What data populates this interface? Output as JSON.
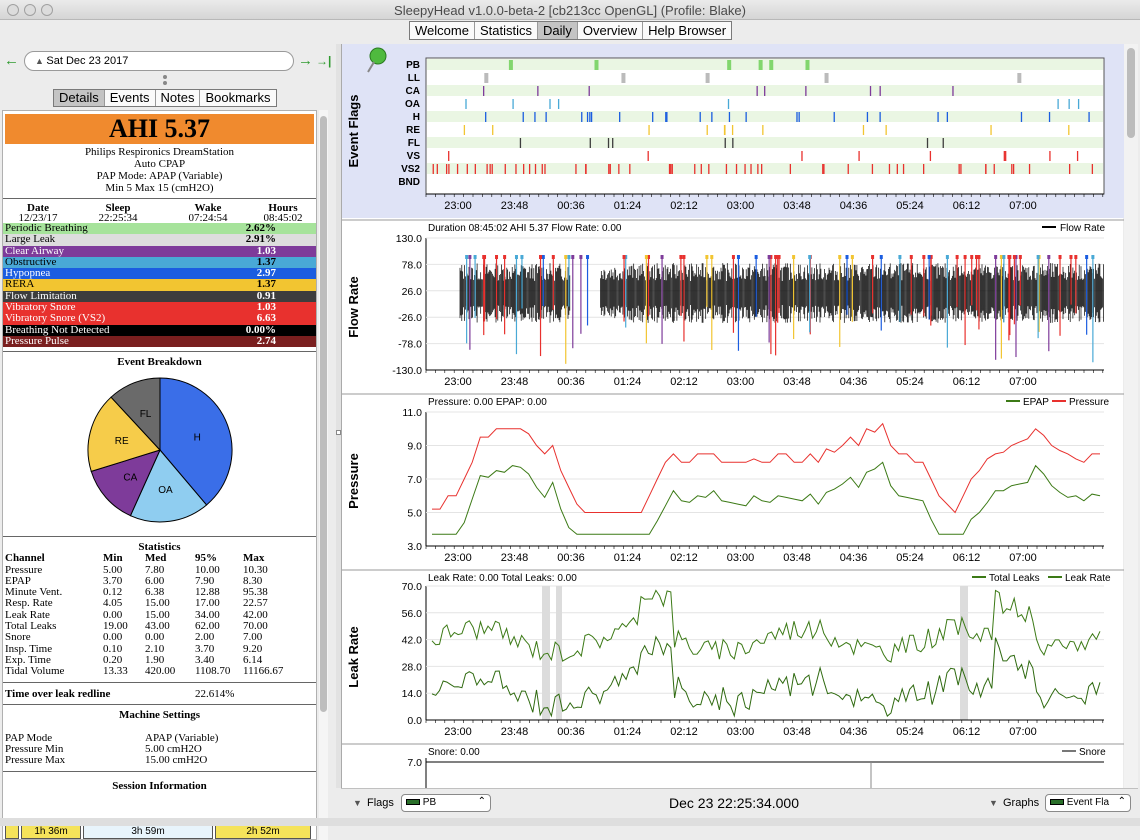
{
  "window": {
    "title": "SleepyHead v1.0.0-beta-2 [cb213cc OpenGL] (Profile: Blake)"
  },
  "tabs": [
    "Welcome",
    "Statistics",
    "Daily",
    "Overview",
    "Help Browser"
  ],
  "active_tab": "Daily",
  "date_nav": {
    "date": "Sat Dec 23 2017",
    "prev": "←",
    "next": "→",
    "last": "→|"
  },
  "subtabs": [
    "Details",
    "Events",
    "Notes",
    "Bookmarks"
  ],
  "report": {
    "ahi": "AHI 5.37",
    "machine": [
      "Philips Respironics DreamStation",
      "Auto CPAP",
      "PAP Mode: APAP (Variable)",
      "Min 5 Max 15 (cmH2O)"
    ],
    "times_header": [
      "Date",
      "Sleep",
      "Wake",
      "Hours"
    ],
    "times": [
      "12/23/17",
      "22:25:34",
      "07:24:54",
      "08:45:02"
    ],
    "events": [
      {
        "name": "Periodic Breathing",
        "value": "2.62%",
        "bg": "#a6e39b",
        "fg": "#000"
      },
      {
        "name": "Large Leak",
        "value": "2.91%",
        "bg": "#dddddd",
        "fg": "#000"
      },
      {
        "name": "Clear Airway",
        "value": "1.03",
        "bg": "#7e3b9a",
        "fg": "#fff"
      },
      {
        "name": "Obstructive",
        "value": "1.37",
        "bg": "#49a9d6",
        "fg": "#000"
      },
      {
        "name": "Hypopnea",
        "value": "2.97",
        "bg": "#1b5de0",
        "fg": "#fff"
      },
      {
        "name": "RERA",
        "value": "1.37",
        "bg": "#f2c531",
        "fg": "#000"
      },
      {
        "name": "Flow Limitation",
        "value": "0.91",
        "bg": "#3d3d3d",
        "fg": "#fff"
      },
      {
        "name": "Vibratory Snore",
        "value": "1.03",
        "bg": "#e8312e",
        "fg": "#fff"
      },
      {
        "name": "Vibratory Snore (VS2)",
        "value": "6.63",
        "bg": "#e8312e",
        "fg": "#fff"
      },
      {
        "name": "Breathing Not Detected",
        "value": "0.00%",
        "bg": "#000000",
        "fg": "#fff"
      },
      {
        "name": "Pressure Pulse",
        "value": "2.74",
        "bg": "#7a1f1f",
        "fg": "#fff"
      }
    ],
    "breakdown_title": "Event Breakdown",
    "pie": [
      {
        "label": "H",
        "pct": 0.297,
        "color": "#3a6ee8"
      },
      {
        "label": "OA",
        "pct": 0.137,
        "color": "#8fcdf0"
      },
      {
        "label": "CA",
        "pct": 0.103,
        "color": "#7e3b9a"
      },
      {
        "label": "RE",
        "pct": 0.137,
        "color": "#f6cc4a"
      },
      {
        "label": "FL",
        "pct": 0.091,
        "color": "#6a6a6a"
      }
    ],
    "stats_title": "Statistics",
    "stats_header": [
      "Channel",
      "Min",
      "Med",
      "95%",
      "Max"
    ],
    "stats": [
      [
        "Pressure",
        "5.00",
        "7.80",
        "10.00",
        "10.30"
      ],
      [
        "EPAP",
        "3.70",
        "6.00",
        "7.90",
        "8.30"
      ],
      [
        "Minute Vent.",
        "0.12",
        "6.38",
        "12.88",
        "95.38"
      ],
      [
        "Resp. Rate",
        "4.05",
        "15.00",
        "17.00",
        "22.57"
      ],
      [
        "Leak Rate",
        "0.00",
        "15.00",
        "34.00",
        "42.00"
      ],
      [
        "Total Leaks",
        "19.00",
        "43.00",
        "62.00",
        "70.00"
      ],
      [
        "Snore",
        "0.00",
        "0.00",
        "2.00",
        "7.00"
      ],
      [
        "Insp. Time",
        "0.10",
        "2.10",
        "3.70",
        "9.20"
      ],
      [
        "Exp. Time",
        "0.20",
        "1.90",
        "3.40",
        "6.14"
      ],
      [
        "Tidal Volume",
        "13.33",
        "420.00",
        "1108.70",
        "11166.67"
      ]
    ],
    "leak_redline_label": "Time over leak redline",
    "leak_redline_value": "22.614%",
    "machine_settings_title": "Machine Settings",
    "settings": [
      [
        "PAP Mode",
        "APAP (Variable)"
      ],
      [
        "Pressure Min",
        "5.00 cmH2O"
      ],
      [
        "Pressure Max",
        "15.00 cmH2O"
      ]
    ],
    "session_info_title": "Session Information",
    "sessions": [
      "1h 36m",
      "3h 59m",
      "2h 52m"
    ]
  },
  "graphs": {
    "time_ticks": [
      "23:00",
      "23:48",
      "00:36",
      "01:24",
      "02:12",
      "03:00",
      "03:48",
      "04:36",
      "05:24",
      "06:12",
      "07:00"
    ],
    "event_flags": {
      "title": "Event Flags",
      "rows": [
        "PB",
        "LL",
        "CA",
        "OA",
        "H",
        "RE",
        "FL",
        "VS",
        "VS2",
        "BND"
      ]
    },
    "flow": {
      "title": "Flow Rate",
      "header": "Duration 08:45:02 AHI 5.37 Flow Rate: 0.00",
      "legend": "Flow Rate",
      "yticks": [
        "130.0",
        "78.0",
        "26.0",
        "-26.0",
        "-78.0",
        "-130.0"
      ]
    },
    "pressure": {
      "title": "Pressure",
      "header": "Pressure: 0.00 EPAP: 0.00",
      "legend": [
        "EPAP",
        "Pressure"
      ],
      "yticks": [
        "11.0",
        "9.0",
        "7.0",
        "5.0",
        "3.0"
      ],
      "colors": {
        "epap": "#3c7a16",
        "pressure": "#e8312e"
      }
    },
    "leak": {
      "title": "Leak Rate",
      "header": "Leak Rate: 0.00 Total Leaks: 0.00",
      "legend": [
        "Total Leaks",
        "Leak Rate"
      ],
      "yticks": [
        "70.0",
        "56.0",
        "42.0",
        "28.0",
        "14.0",
        "0.0"
      ]
    },
    "snore": {
      "header": "Snore: 0.00",
      "legend": "Snore",
      "yticks": [
        "7.0"
      ]
    }
  },
  "bottombar": {
    "flags_label": "Flags",
    "flags_value": "PB",
    "datetime": "Dec 23 22:25:34.000",
    "graphs_label": "Graphs",
    "graphs_value": "Event Fla"
  }
}
